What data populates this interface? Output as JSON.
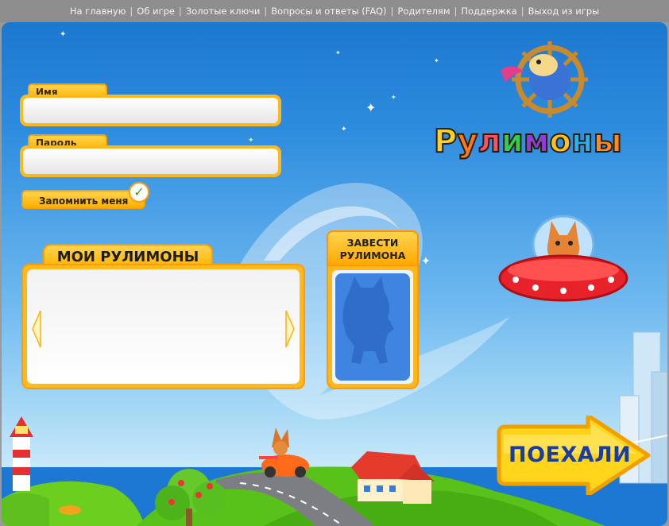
{
  "topnav": {
    "links": [
      "На главную",
      "Об игре",
      "Золотые ключи",
      "Вопросы и ответы (FAQ)",
      "Родителям",
      "Поддержка",
      "Выход из игры"
    ],
    "separator": "|"
  },
  "login": {
    "name_label": "Имя",
    "name_value": "",
    "password_label": "Пароль",
    "password_value": "",
    "remember_label": "Запомнить меня",
    "remember_checked": true,
    "check_glyph": "✓"
  },
  "my_rulimons": {
    "title": "МОИ РУЛИМОНЫ"
  },
  "new_rulimon": {
    "label_line1": "ЗАВЕСТИ",
    "label_line2": "РУЛИМОНА"
  },
  "brand": {
    "logo_text": "Рулимоны",
    "logo_letters": [
      "Р",
      "у",
      "л",
      "и",
      "м",
      "о",
      "н",
      "ы"
    ],
    "logo_colors": [
      "#ffd21e",
      "#ff7a16",
      "#ff4f6a",
      "#2fd04a",
      "#8b3fd6",
      "#ffc21a",
      "#22b3ff",
      "#ff8a1e"
    ]
  },
  "go_button": {
    "label": "ПОЕХАЛИ"
  },
  "colors": {
    "accent_orange": "#ffb000",
    "accent_border": "#ff9a00",
    "sky_top": "#1b78cf",
    "button_text": "#1b3e9e"
  }
}
